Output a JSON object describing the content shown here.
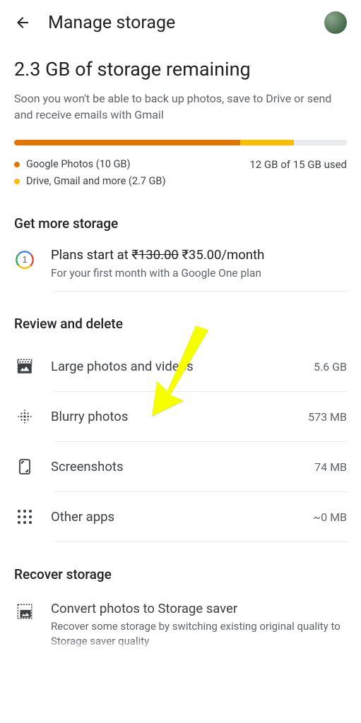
{
  "header": {
    "title": "Manage storage"
  },
  "hero": {
    "title": "2.3 GB of storage remaining",
    "description": "Soon you won't be able to back up photos, save to Drive or send and receive emails with Gmail"
  },
  "usage": {
    "summary": "12 GB of 15 GB used",
    "legend": {
      "photos": "Google Photos (10 GB)",
      "drive": "Drive, Gmail and more (2.7 GB)"
    },
    "colors": {
      "photos": "#e37400",
      "drive": "#fbbc04",
      "empty": "#e8eaed"
    }
  },
  "sections": {
    "get_more": "Get more storage",
    "review": "Review and delete",
    "recover": "Recover storage"
  },
  "plan": {
    "prefix": "Plans start at ",
    "old_price": "₹130.00",
    "new_price": " ₹35.00/month",
    "subtext": "For your first month with a Google One plan"
  },
  "review_items": [
    {
      "label": "Large photos and videos",
      "value": "5.6 GB"
    },
    {
      "label": "Blurry photos",
      "value": "573 MB"
    },
    {
      "label": "Screenshots",
      "value": "74 MB"
    },
    {
      "label": "Other apps",
      "value": "~0 MB"
    }
  ],
  "recover_item": {
    "title": "Convert photos to Storage saver",
    "subtext": "Recover some storage by switching existing original quality to Storage saver quality"
  }
}
